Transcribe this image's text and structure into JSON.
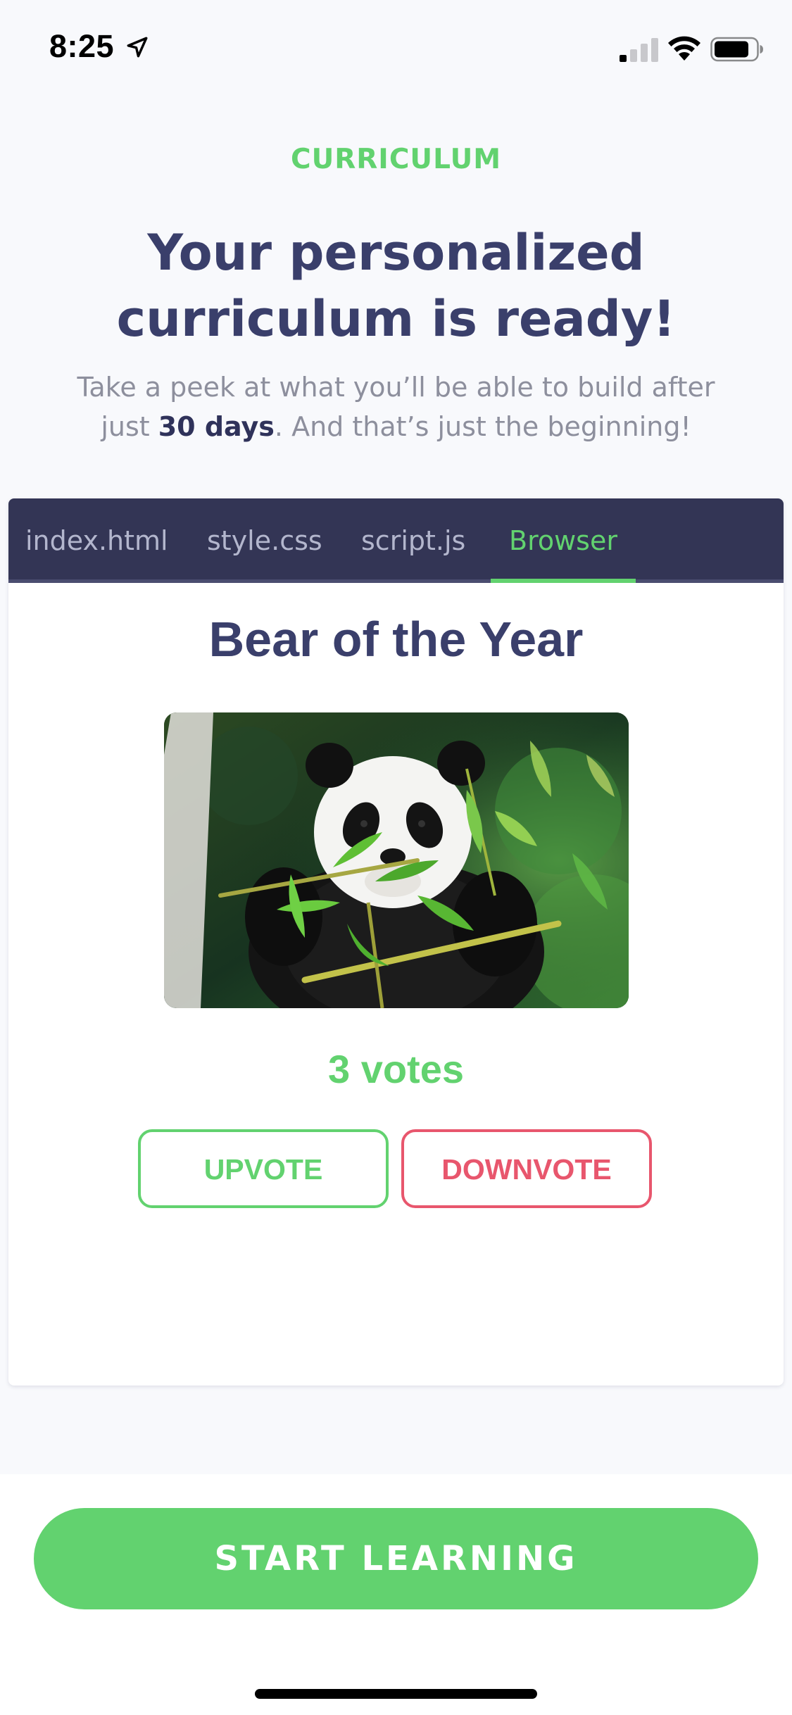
{
  "status_bar": {
    "time": "8:25",
    "icons": [
      "location-arrow-icon",
      "cellular-signal-icon",
      "wifi-icon",
      "battery-icon"
    ]
  },
  "header": {
    "eyebrow": "CURRICULUM",
    "title_line1": "Your personalized",
    "title_line2": "curriculum is ready!",
    "subtitle_line1": "Take a peek at what you’ll be able to build after",
    "subtitle_line2_prefix": "just ",
    "subtitle_line2_bold": "30 days",
    "subtitle_line2_suffix": ". And that’s just the beginning!"
  },
  "editor": {
    "tabs": [
      {
        "label": "index.html",
        "active": false
      },
      {
        "label": "style.css",
        "active": false
      },
      {
        "label": "script.js",
        "active": false
      },
      {
        "label": "Browser",
        "active": true
      }
    ]
  },
  "preview": {
    "heading": "Bear of the Year",
    "image_subject": "panda-photo",
    "votes_label": "3 votes",
    "upvote_label": "UPVOTE",
    "downvote_label": "DOWNVOTE"
  },
  "footer": {
    "cta_label": "START LEARNING"
  },
  "colors": {
    "accent_green": "#62d26f",
    "downvote_red": "#e8566d",
    "navy_text": "#3a3f6b",
    "tabbar_bg": "#333555",
    "page_bg": "#f8f9fc"
  }
}
